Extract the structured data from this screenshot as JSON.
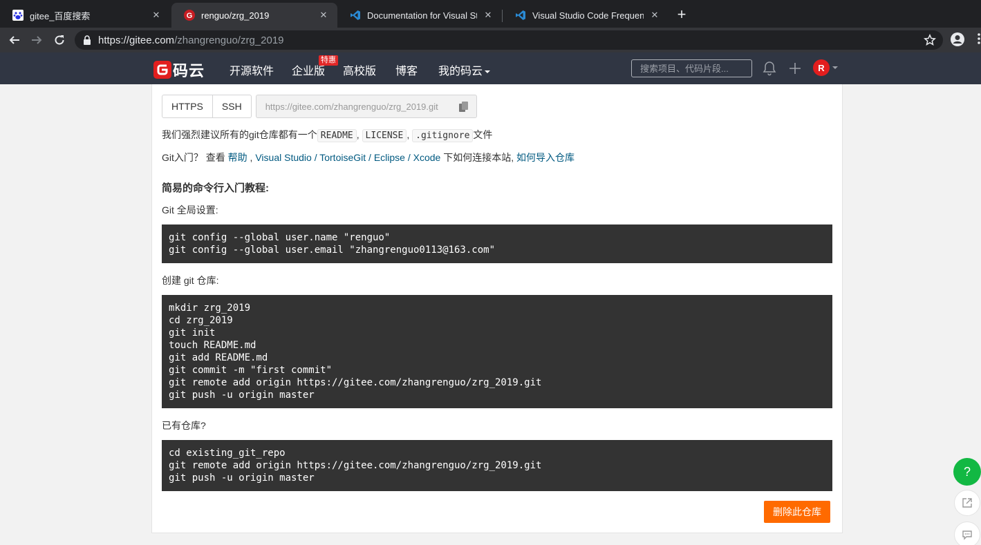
{
  "browser": {
    "tabs": [
      {
        "title": "gitee_百度搜索"
      },
      {
        "title": "renguo/zrg_2019"
      },
      {
        "title": "Documentation for Visual Studi"
      },
      {
        "title": "Visual Studio Code Frequently"
      }
    ],
    "new_tab": "+",
    "url_host": "https://gitee.com",
    "url_path": "/zhangrenguo/zrg_2019"
  },
  "site": {
    "logo_text": "码云",
    "nav": [
      "开源软件",
      "企业版",
      "高校版",
      "博客",
      "我的码云"
    ],
    "badge": "特惠",
    "search_placeholder": "搜索项目、代码片段...",
    "avatar_letter": "R"
  },
  "clone": {
    "https_label": "HTTPS",
    "ssh_label": "SSH",
    "url": "https://gitee.com/zhangrenguo/zrg_2019.git"
  },
  "recommend": {
    "prefix": "我们强烈建议所有的git仓库都有一个",
    "files": [
      "README",
      "LICENSE",
      ".gitignore"
    ],
    "sep": ",",
    "suffix": "文件"
  },
  "intro": {
    "prefix": "Git入门？ 查看 ",
    "help": "帮助",
    "comma": " , ",
    "vs": "Visual Studio",
    "slash1": " / ",
    "tortoise": "TortoiseGit",
    "slash2": " / ",
    "eclipse": "Eclipse",
    "slash3": " / ",
    "xcode": "Xcode",
    "middle": " 下如何连接本站, ",
    "import": "如何导入仓库"
  },
  "tutorial": {
    "heading": "简易的命令行入门教程:",
    "global_label": "Git 全局设置:",
    "global_code": "git config --global user.name \"renguo\"\ngit config --global user.email \"zhangrenguo0113@163.com\"",
    "create_label": "创建 git 仓库:",
    "create_code": "mkdir zrg_2019\ncd zrg_2019\ngit init\ntouch README.md\ngit add README.md\ngit commit -m \"first commit\"\ngit remote add origin https://gitee.com/zhangrenguo/zrg_2019.git\ngit push -u origin master",
    "existing_label": "已有仓库?",
    "existing_code": "cd existing_git_repo\ngit remote add origin https://gitee.com/zhangrenguo/zrg_2019.git\ngit push -u origin master"
  },
  "delete_button": "删除此仓库",
  "float_help": "?",
  "colors": {
    "header_bg": "#303643",
    "brand_red": "#e21e1e",
    "danger_orange": "#ff6a00",
    "help_green": "#12b843",
    "link_blue": "#005980"
  }
}
